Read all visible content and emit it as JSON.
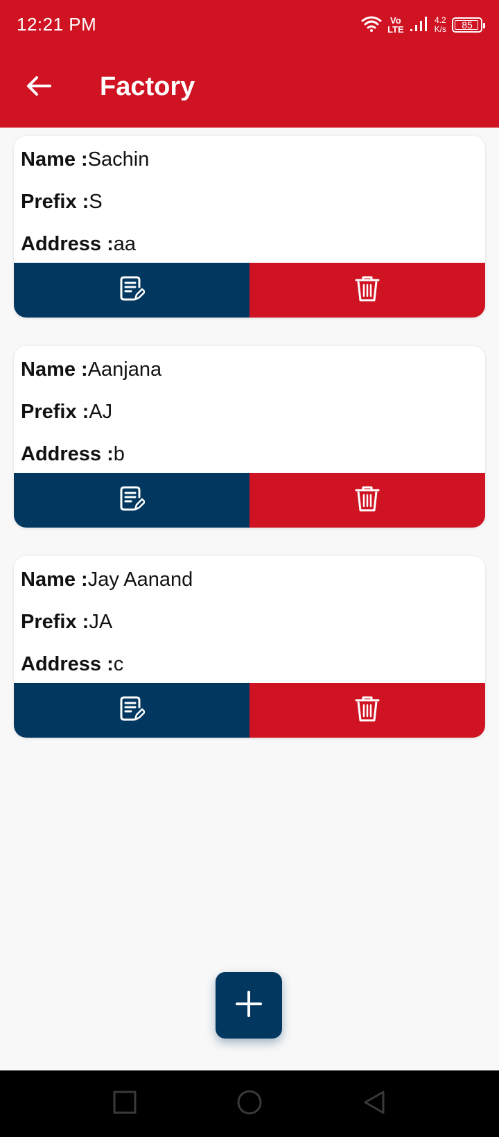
{
  "status_bar": {
    "time": "12:21 PM",
    "lte_top": "Vo",
    "lte_bottom": "LTE",
    "speed_top": "4.2",
    "speed_bottom": "K/s",
    "battery": "85",
    "icons": [
      "wifi-icon",
      "volte-icon",
      "signal-icon",
      "battery-icon"
    ]
  },
  "appbar": {
    "title": "Factory",
    "back_icon": "arrow-left-icon",
    "color": "#cf1322"
  },
  "labels": {
    "name": "Name :",
    "prefix": "Prefix :",
    "address": "Address :"
  },
  "factories": [
    {
      "name": "Sachin",
      "prefix": "S",
      "address": "aa"
    },
    {
      "name": "Aanjana",
      "prefix": "AJ",
      "address": "b"
    },
    {
      "name": "Jay Aanand",
      "prefix": "JA",
      "address": "c"
    }
  ],
  "actions": {
    "edit_icon": "edit-note-icon",
    "delete_icon": "trash-icon",
    "edit_color": "#023760",
    "delete_color": "#cf1322"
  },
  "fab": {
    "icon": "plus-icon"
  },
  "nav": {
    "icons": [
      "recents-square-icon",
      "home-circle-icon",
      "back-triangle-icon"
    ]
  }
}
